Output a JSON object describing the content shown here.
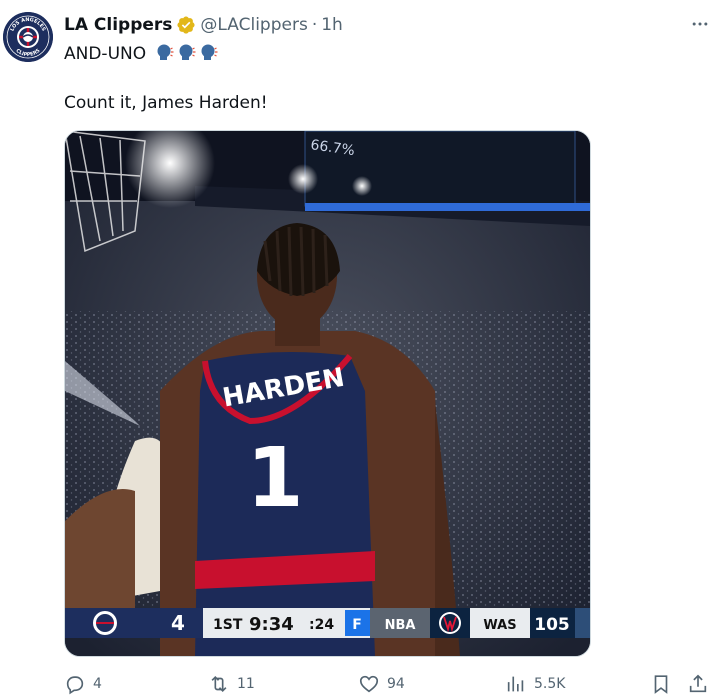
{
  "tweet": {
    "display_name": "LA Clippers",
    "handle": "@LAClippers",
    "separator": "·",
    "time": "1h",
    "line1": "AND-UNO",
    "line2": "Count it, James Harden!"
  },
  "avatar": {
    "top_text": "LOS ANGELES",
    "bottom_text": "CLIPPERS"
  },
  "media": {
    "jersey_name": "HARDEN",
    "jersey_number": "1",
    "stat_board_text": "66.7%",
    "scoreboard": {
      "home_score": "4",
      "period": "1ST",
      "clock": "9:34",
      "shot_clock": ":24",
      "network": "NBA",
      "away_team": "WAS",
      "away_score": "105"
    }
  },
  "actions": {
    "replies": "4",
    "reposts": "11",
    "likes": "94",
    "views": "5.5K"
  },
  "colors": {
    "clippers_navy": "#1d2e5e",
    "clippers_red": "#c8102e",
    "verified_gold": "#e2b719",
    "secondary_text": "#536471"
  }
}
